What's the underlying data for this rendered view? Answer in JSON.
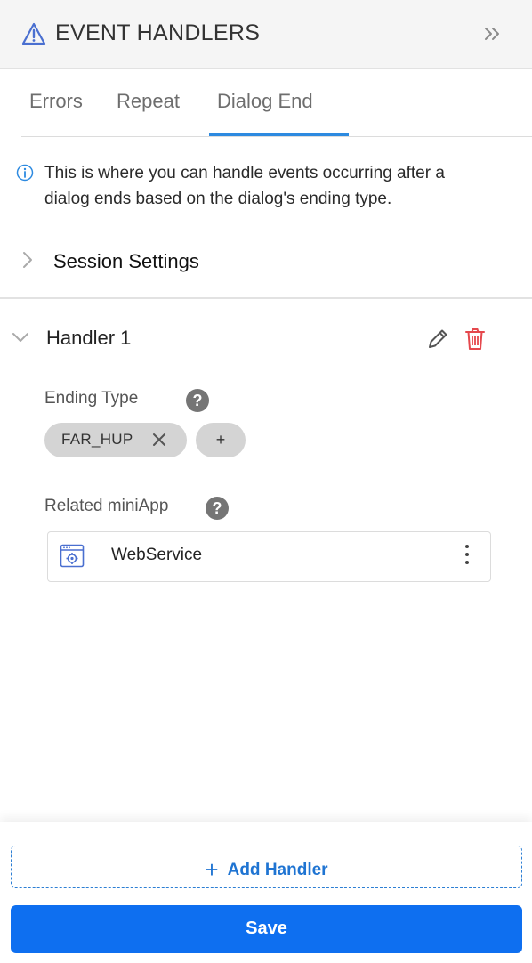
{
  "header": {
    "title": "EVENT HANDLERS",
    "icon": "warning-triangle-icon",
    "collapse_icon": "double-chevron-right-icon"
  },
  "tabs": [
    {
      "label": "Errors",
      "active": false
    },
    {
      "label": "Repeat",
      "active": false
    },
    {
      "label": "Dialog End",
      "active": true
    }
  ],
  "info": {
    "icon": "info-icon",
    "text": "This is where you can handle events occurring after a dialog ends based on the dialog's ending type."
  },
  "session_settings": {
    "label": "Session Settings",
    "expanded": false
  },
  "handler": {
    "title": "Handler 1",
    "expanded": true,
    "ending_type": {
      "label": "Ending Type",
      "help": "?",
      "chips": [
        {
          "label": "FAR_HUP"
        }
      ],
      "add_label": "+"
    },
    "related_miniapp": {
      "label": "Related miniApp",
      "help": "?",
      "item": {
        "name": "WebService",
        "icon": "webservice-icon"
      }
    }
  },
  "footer": {
    "add_handler_label": "Add Handler",
    "save_label": "Save"
  },
  "colors": {
    "accent": "#2d8ae0",
    "primary_button": "#0e6ff0",
    "delete": "#e5484d",
    "chip": "#d4d4d4",
    "header_bg": "#f5f5f5"
  }
}
